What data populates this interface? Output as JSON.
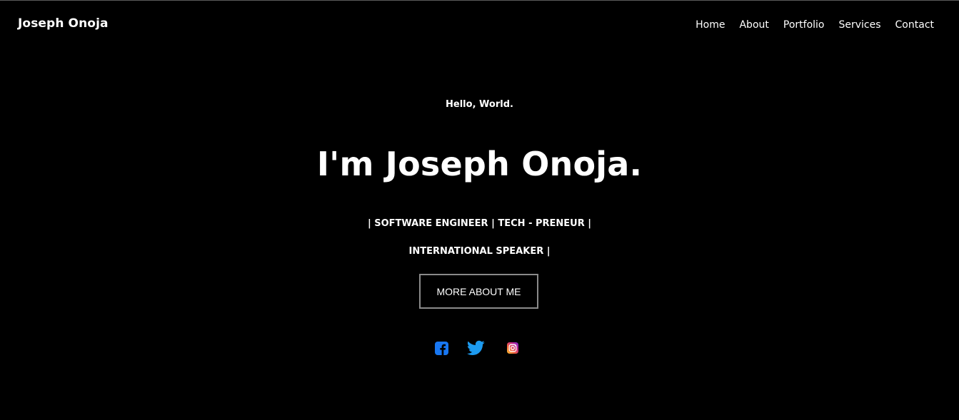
{
  "header": {
    "brand": "Joseph Onoja",
    "nav": [
      {
        "label": "Home"
      },
      {
        "label": "About"
      },
      {
        "label": "Portfolio"
      },
      {
        "label": "Services"
      },
      {
        "label": "Contact"
      }
    ]
  },
  "hero": {
    "greeting": "Hello, World.",
    "headline": "I'm Joseph Onoja.",
    "tagline_line1": "| SOFTWARE ENGINEER | TECH - PRENEUR |",
    "tagline_line2": "INTERNATIONAL SPEAKER |",
    "cta_label": "MORE ABOUT ME"
  },
  "social": {
    "icons": [
      "facebook-icon",
      "twitter-icon",
      "instagram-icon"
    ]
  },
  "colors": {
    "background": "#000000",
    "text": "#ffffff",
    "facebook": "#1877f2",
    "twitter": "#1d9bf0",
    "button_border": "#8a8a8a"
  }
}
